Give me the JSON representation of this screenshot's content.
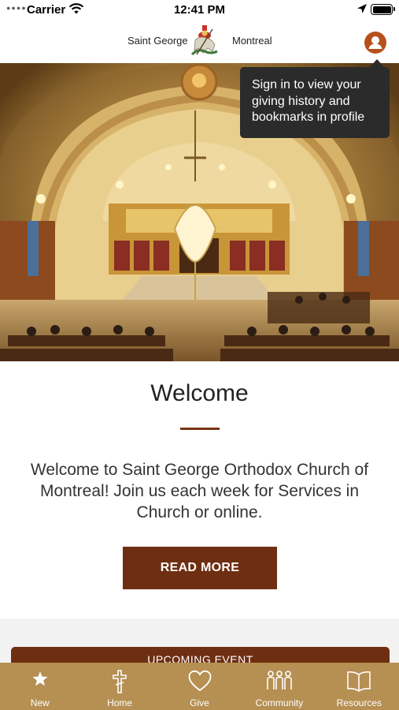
{
  "status_bar": {
    "carrier": "Carrier",
    "time": "12:41 PM"
  },
  "header": {
    "brand_left": "Saint George",
    "brand_right": "Montreal",
    "icons": [
      "st-george-logo",
      "profile-icon"
    ],
    "accent_color": "#b5501c"
  },
  "tooltip": {
    "text": "Sign in to view your giving history and bookmarks in profile"
  },
  "welcome": {
    "title": "Welcome",
    "body": "Welcome to Saint George Orthodox Church of Montreal! Join us each week for Services in Church or online.",
    "button_label": "READ MORE",
    "button_color": "#6e2e12"
  },
  "upcoming_event": {
    "label": "UPCOMING EVENT"
  },
  "tab_bar": {
    "color": "#b68f52",
    "tabs": [
      {
        "label": "New",
        "icon": "star-icon"
      },
      {
        "label": "Home",
        "icon": "cross-icon"
      },
      {
        "label": "Give",
        "icon": "heart-icon"
      },
      {
        "label": "Community",
        "icon": "people-icon"
      },
      {
        "label": "Resources",
        "icon": "book-icon"
      }
    ]
  }
}
